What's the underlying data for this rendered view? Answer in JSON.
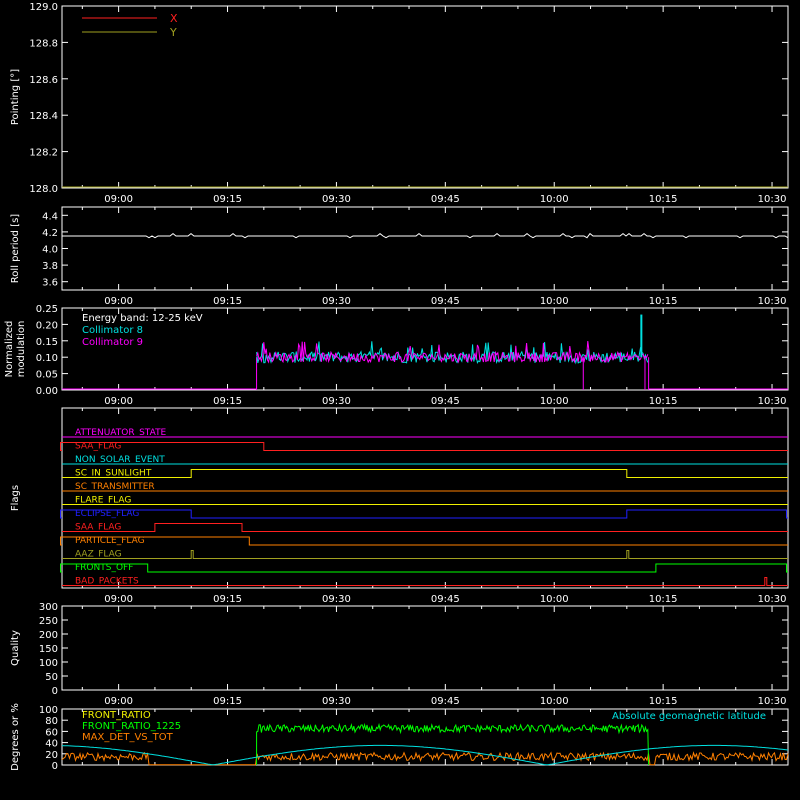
{
  "colors": {
    "background": "#000000",
    "axis": "#ffffff",
    "x": "#ff2020",
    "y": "#a0a020",
    "roll": "#ffffff",
    "coll8": "#00e0e0",
    "coll9": "#ff00ff",
    "front_ratio": "#f0f000",
    "front_ratio_1225": "#00ff00",
    "max_det": "#ff8000",
    "geomag": "#00e0e0"
  },
  "time_axis": {
    "ticks": [
      "09:00",
      "09:15",
      "09:30",
      "09:45",
      "10:00",
      "10:15",
      "10:30"
    ]
  },
  "chart_data": [
    {
      "type": "line",
      "ylabel": "Pointing [°]",
      "ylim": [
        128.0,
        129.0
      ],
      "yticks": [
        "128.0",
        "128.2",
        "128.4",
        "128.6",
        "128.8",
        "129.0"
      ],
      "legend_placement": "top-left",
      "series": [
        {
          "name": "X",
          "color": "#ff2020",
          "values": []
        },
        {
          "name": "Y",
          "color": "#a0a020",
          "values": []
        }
      ]
    },
    {
      "type": "line",
      "ylabel": "Roll period [s]",
      "ylim": [
        3.5,
        4.5
      ],
      "yticks": [
        "3.6",
        "3.8",
        "4.0",
        "4.2",
        "4.4"
      ],
      "series": [
        {
          "color": "#ffffff",
          "x": [
            "08:52",
            "10:32"
          ],
          "values": [
            4.15,
            4.15
          ]
        }
      ]
    },
    {
      "type": "line",
      "ylabel": "Normalized modulation",
      "ylim": [
        0.0,
        0.25
      ],
      "yticks": [
        "0.00",
        "0.05",
        "0.10",
        "0.15",
        "0.20",
        "0.25"
      ],
      "annotation": "Energy band: 12-25 keV",
      "legend_placement": "top-left",
      "series": [
        {
          "name": "Collimator 8",
          "color": "#00e0e0",
          "start": "09:19",
          "end": "10:13",
          "typical": 0.1,
          "max": 0.23
        },
        {
          "name": "Collimator 9",
          "color": "#ff00ff",
          "start": "09:19",
          "end": "10:13",
          "typical": 0.1,
          "max": 0.18
        }
      ]
    },
    {
      "type": "table",
      "ylabel": "Flags",
      "flags": [
        {
          "name": "ATTENUATOR_STATE",
          "color": "#ff00ff",
          "high": []
        },
        {
          "name": "SAA_FLAG",
          "color": "#ff2020",
          "high": [
            [
              "08:52",
              "09:20"
            ]
          ]
        },
        {
          "name": "NON_SOLAR_EVENT",
          "color": "#00e0e0",
          "high": []
        },
        {
          "name": "SC_IN_SUNLIGHT",
          "color": "#f0f000",
          "high": [
            [
              "09:10",
              "10:10"
            ]
          ]
        },
        {
          "name": "SC_TRANSMITTER",
          "color": "#ff8000",
          "high": []
        },
        {
          "name": "FLARE_FLAG",
          "color": "#f0f000",
          "high": []
        },
        {
          "name": "ECLIPSE_FLAG",
          "color": "#2020ff",
          "high": [
            [
              "08:52",
              "09:10"
            ],
            [
              "10:10",
              "10:32"
            ]
          ]
        },
        {
          "name": "SAA_FLAG",
          "color": "#ff2020",
          "high": [
            [
              "09:05",
              "09:17"
            ]
          ]
        },
        {
          "name": "PARTICLE_FLAG",
          "color": "#ff8000",
          "high": [
            [
              "08:52",
              "09:18"
            ]
          ]
        },
        {
          "name": "AAZ_FLAG",
          "color": "#a0a020",
          "high": [
            [
              "09:10",
              "09:10"
            ],
            [
              "10:10",
              "10:10"
            ]
          ]
        },
        {
          "name": "FRONTS_OFF",
          "color": "#00ff00",
          "high": [
            [
              "08:52",
              "09:04"
            ],
            [
              "10:14",
              "10:32"
            ]
          ]
        },
        {
          "name": "BAD_PACKETS",
          "color": "#ff2020",
          "high": [
            [
              "10:29",
              "10:29"
            ]
          ]
        }
      ]
    },
    {
      "type": "line",
      "ylabel": "Quality",
      "ylim": [
        0,
        300
      ],
      "yticks": [
        "0",
        "50",
        "100",
        "150",
        "200",
        "250",
        "300"
      ],
      "series": []
    },
    {
      "type": "line",
      "ylabel": "Degrees or %",
      "ylim": [
        0,
        100
      ],
      "yticks": [
        "0",
        "20",
        "40",
        "60",
        "80",
        "100"
      ],
      "legend_placement": "top-left",
      "annotation": "Absolute geomagnetic latitude",
      "series": [
        {
          "name": "FRONT_RATIO",
          "color": "#f0f000"
        },
        {
          "name": "FRONT_RATIO_1225",
          "color": "#00ff00",
          "start": "09:19",
          "end": "10:13",
          "typical": 65
        },
        {
          "name": "MAX_DET_VS_TOT",
          "color": "#ff8000",
          "typical": 15
        },
        {
          "name": "Absolute geomagnetic latitude",
          "color": "#00e0e0",
          "min": 0,
          "max": 35
        }
      ]
    }
  ]
}
